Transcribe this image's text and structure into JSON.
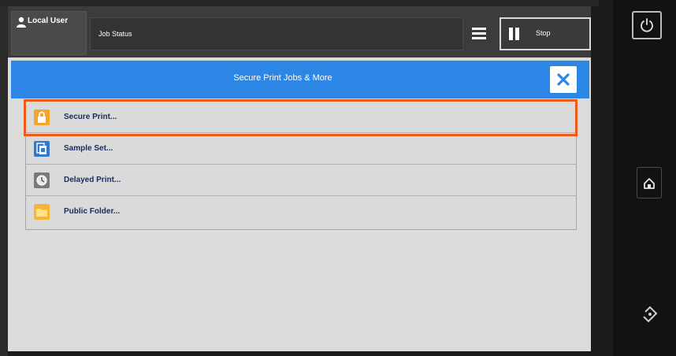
{
  "topbar": {
    "user_label": "Local User",
    "job_status_label": "Job Status",
    "stop_label": "Stop"
  },
  "header": {
    "title": "Secure Print Jobs & More"
  },
  "list": {
    "items": [
      {
        "label": "Secure Print...",
        "icon": "lock-icon"
      },
      {
        "label": "Sample Set...",
        "icon": "sample-set-icon"
      },
      {
        "label": "Delayed Print...",
        "icon": "clock-icon"
      },
      {
        "label": "Public Folder...",
        "icon": "folder-icon"
      }
    ]
  },
  "colors": {
    "header_blue": "#2b86e5",
    "highlight_orange": "#ef5a1a"
  }
}
